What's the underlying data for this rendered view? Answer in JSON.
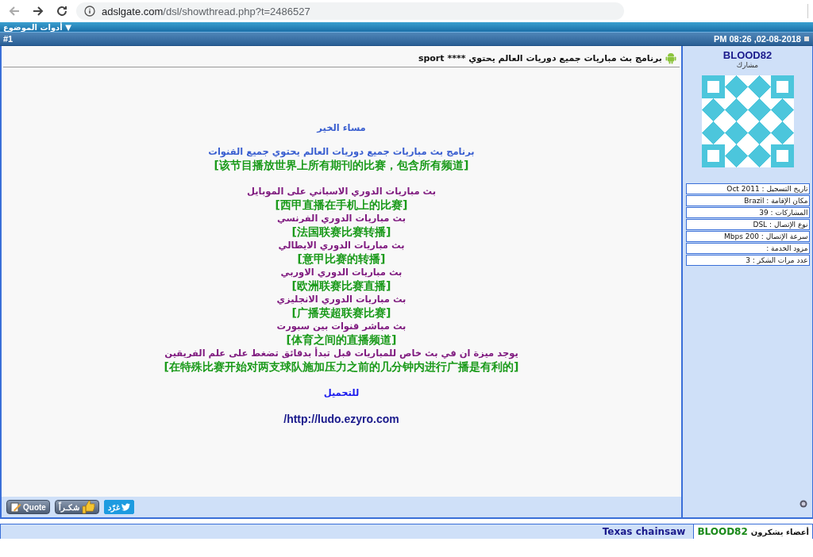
{
  "browser": {
    "url_host": "adslgate.com",
    "url_path": "/dsl/showthread.php?t=2486527"
  },
  "thread_tools": {
    "label": "أدوات الموضوع",
    "caret": "▼"
  },
  "post": {
    "number": "#1",
    "date": "PM 08:26 ,02-08-2018",
    "title": "برنامج بث مباريات جميع دوريات العالم يحتوي **** sport",
    "lines": [
      {
        "kind": "spacer"
      },
      {
        "kind": "arabic",
        "text": "مساء الخير",
        "color": "#3a5fd0"
      },
      {
        "kind": "spacer"
      },
      {
        "kind": "arabic",
        "text": "برنامج بث مباريات جميع دوريات العالم يحتوي جميع القنوات",
        "color": "#3a5fd0"
      },
      {
        "kind": "chinese",
        "text": "[该节目播放世界上所有期刊的比赛，包含所有频道]",
        "color": "#1a9a1a"
      },
      {
        "kind": "spacer"
      },
      {
        "kind": "arabic",
        "text": "بث مباريات الدوري الاسباني على الموبايل",
        "color": "#7f1a7f"
      },
      {
        "kind": "chinese",
        "text": "[西甲直播在手机上的比赛]",
        "color": "#1a9a1a"
      },
      {
        "kind": "arabic",
        "text": "بث مباريات الدوري الفرنسي",
        "color": "#7f1a7f"
      },
      {
        "kind": "chinese",
        "text": "[法国联赛比赛转播]",
        "color": "#1a9a1a"
      },
      {
        "kind": "arabic",
        "text": "بث مباريات الدوري الايطالي",
        "color": "#7f1a7f"
      },
      {
        "kind": "chinese",
        "text": "[意甲比赛的转播]",
        "color": "#1a9a1a"
      },
      {
        "kind": "arabic",
        "text": "بث مباريات الدوري الاوربي",
        "color": "#7f1a7f"
      },
      {
        "kind": "chinese",
        "text": "[欧洲联赛比赛直播]",
        "color": "#1a9a1a"
      },
      {
        "kind": "arabic",
        "text": "بث مباريات الدوري الانجليزي",
        "color": "#7f1a7f"
      },
      {
        "kind": "chinese",
        "text": "[广播英超联赛比赛]",
        "color": "#1a9a1a"
      },
      {
        "kind": "arabic",
        "text": "بث مباشر قنوات بين سبورت",
        "color": "#7f1a7f"
      },
      {
        "kind": "chinese",
        "text": "[体育之间的直播频道]",
        "color": "#1a9a1a"
      },
      {
        "kind": "arabic",
        "text": "يوجد ميزة ان في بث خاص للمباريات قبل تبدأ بدقائق تضغط على علم الفريقين",
        "color": "#7f1a7f"
      },
      {
        "kind": "chinese",
        "text": "[在特殊比赛开始对两支球队施加压力之前的几分钟内进行广播是有利的]",
        "color": "#1a9a1a"
      },
      {
        "kind": "spacer"
      },
      {
        "kind": "arabic",
        "text": "للتحميل",
        "color": "#1a1aee"
      },
      {
        "kind": "spacer"
      },
      {
        "kind": "link",
        "text": "/http://ludo.ezyro.com",
        "color": "#1a1a8c"
      }
    ],
    "buttons": [
      {
        "kind": "tweet",
        "label": "غرّد"
      },
      {
        "kind": "thanks",
        "label": "شكـراً"
      },
      {
        "kind": "quote",
        "label": "Quote"
      }
    ]
  },
  "user": {
    "name": "BLOOD82",
    "rank": "مشارك",
    "info": [
      "تاريخ التسجيل : Oct 2011",
      "مكان الإقامة : Brazil",
      "المشاركات : 39",
      "نوع الإتصال : DSL",
      "سرعة الإتصال : 200 Mbps",
      "مزود الخدمة :",
      "عدد مرات الشكر : 3"
    ]
  },
  "thanks": {
    "label": "أعضاء يشكرون",
    "author": "BLOOD82",
    "members": [
      "Texas chainsaw"
    ]
  }
}
